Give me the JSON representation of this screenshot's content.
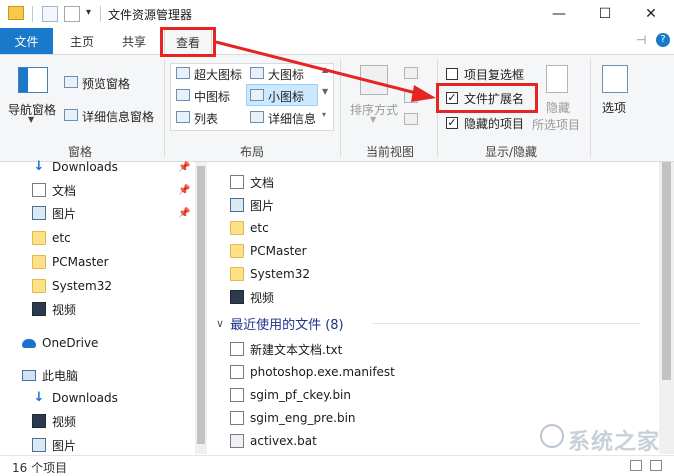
{
  "window": {
    "title": "文件资源管理器",
    "minimize": "—",
    "maximize": "☐",
    "close": "✕"
  },
  "tabs": {
    "file": "文件",
    "home": "主页",
    "share": "共享",
    "view": "查看"
  },
  "ribbon": {
    "pane_group": {
      "nav_pane": "导航窗格",
      "preview_pane": "预览窗格",
      "details_pane": "详细信息窗格",
      "label": "窗格"
    },
    "layout_group": {
      "extra_large_icons": "超大图标",
      "large_icons": "大图标",
      "medium_icons": "中图标",
      "small_icons": "小图标",
      "list": "列表",
      "details": "详细信息",
      "label": "布局"
    },
    "current_view_group": {
      "sort_by": "排序方式",
      "label": "当前视图"
    },
    "show_hide_group": {
      "item_checkboxes": "项目复选框",
      "file_extensions": "文件扩展名",
      "hidden_items": "隐藏的项目",
      "hide_selected": "隐藏",
      "hide_selected_sub": "所选项目",
      "label": "显示/隐藏",
      "item_checkboxes_checked": false,
      "file_extensions_checked": true,
      "hidden_items_checked": true
    },
    "options": "选项"
  },
  "nav": {
    "quick_access": [
      {
        "label": "Downloads",
        "icon": "download-icon"
      },
      {
        "label": "文档",
        "icon": "document-icon"
      },
      {
        "label": "图片",
        "icon": "picture-icon"
      },
      {
        "label": "etc",
        "icon": "folder-icon"
      },
      {
        "label": "PCMaster",
        "icon": "folder-icon"
      },
      {
        "label": "System32",
        "icon": "folder-icon"
      },
      {
        "label": "视频",
        "icon": "video-icon"
      }
    ],
    "onedrive": "OneDrive",
    "this_pc": "此电脑",
    "this_pc_items": [
      {
        "label": "Downloads",
        "icon": "download-icon"
      },
      {
        "label": "视频",
        "icon": "video-icon"
      },
      {
        "label": "图片",
        "icon": "picture-icon"
      }
    ]
  },
  "content": {
    "folders": [
      {
        "label": "文档",
        "icon": "document-icon"
      },
      {
        "label": "图片",
        "icon": "picture-icon"
      },
      {
        "label": "etc",
        "icon": "folder-icon"
      },
      {
        "label": "PCMaster",
        "icon": "folder-icon"
      },
      {
        "label": "System32",
        "icon": "folder-icon"
      },
      {
        "label": "视频",
        "icon": "video-icon"
      }
    ],
    "recent_header": "最近使用的文件 (8)",
    "recent_files": [
      {
        "label": "新建文本文档.txt",
        "icon": "text-file-icon"
      },
      {
        "label": "photoshop.exe.manifest",
        "icon": "file-icon"
      },
      {
        "label": "sgim_pf_ckey.bin",
        "icon": "file-icon"
      },
      {
        "label": "sgim_eng_pre.bin",
        "icon": "file-icon"
      },
      {
        "label": "activex.bat",
        "icon": "batch-file-icon"
      }
    ]
  },
  "status": {
    "item_count": "16 个项目"
  },
  "watermark": "系统之家",
  "colors": {
    "accent": "#1979ca",
    "highlight": "#e52523"
  }
}
